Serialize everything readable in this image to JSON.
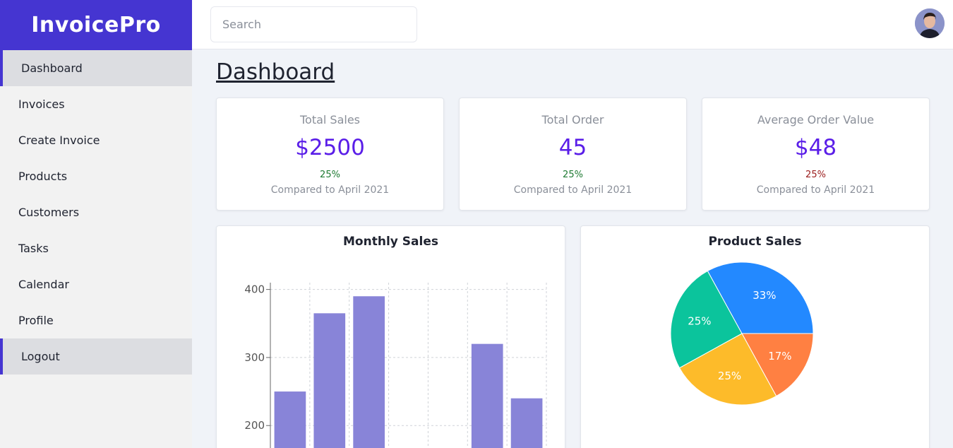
{
  "app": {
    "brand": "InvoicePro"
  },
  "sidebar": {
    "items": [
      {
        "label": "Dashboard",
        "active": true
      },
      {
        "label": "Invoices",
        "active": false
      },
      {
        "label": "Create Invoice",
        "active": false
      },
      {
        "label": "Products",
        "active": false
      },
      {
        "label": "Customers",
        "active": false
      },
      {
        "label": "Tasks",
        "active": false
      },
      {
        "label": "Calendar",
        "active": false
      },
      {
        "label": "Profile",
        "active": false
      },
      {
        "label": "Logout",
        "active": true
      }
    ]
  },
  "topbar": {
    "search_placeholder": "Search"
  },
  "main": {
    "title": "Dashboard",
    "stats": [
      {
        "label": "Total Sales",
        "value": "$2500",
        "change": "25%",
        "change_color": "#1e7a32",
        "compare": "Compared to April 2021"
      },
      {
        "label": "Total Order",
        "value": "45",
        "change": "25%",
        "change_color": "#1e7a32",
        "compare": "Compared to April 2021"
      },
      {
        "label": "Average Order Value",
        "value": "$48",
        "change": "25%",
        "change_color": "#9b1c1c",
        "compare": "Compared to April 2021"
      }
    ],
    "monthly_sales_title": "Monthly Sales",
    "product_sales_title": "Product Sales"
  },
  "colors": {
    "accent": "#4535d1",
    "value": "#5a1ee8",
    "bar": "#8884d8"
  },
  "chart_data": [
    {
      "type": "bar",
      "title": "Monthly Sales",
      "categories": [
        "",
        "",
        "",
        "",
        "",
        "",
        ""
      ],
      "values": [
        250,
        365,
        390,
        null,
        null,
        320,
        240
      ],
      "yticks": [
        200,
        300,
        400
      ],
      "ylim": [
        140,
        410
      ],
      "grid": true,
      "color": "#8884d8"
    },
    {
      "type": "pie",
      "title": "Product Sales",
      "slices": [
        {
          "label": "33%",
          "value": 33,
          "color": "#2389ff"
        },
        {
          "label": "17%",
          "value": 17,
          "color": "#ff8042"
        },
        {
          "label": "25%",
          "value": 25,
          "color": "#fdbb2a"
        },
        {
          "label": "25%",
          "value": 25,
          "color": "#0bc49c"
        }
      ]
    }
  ]
}
